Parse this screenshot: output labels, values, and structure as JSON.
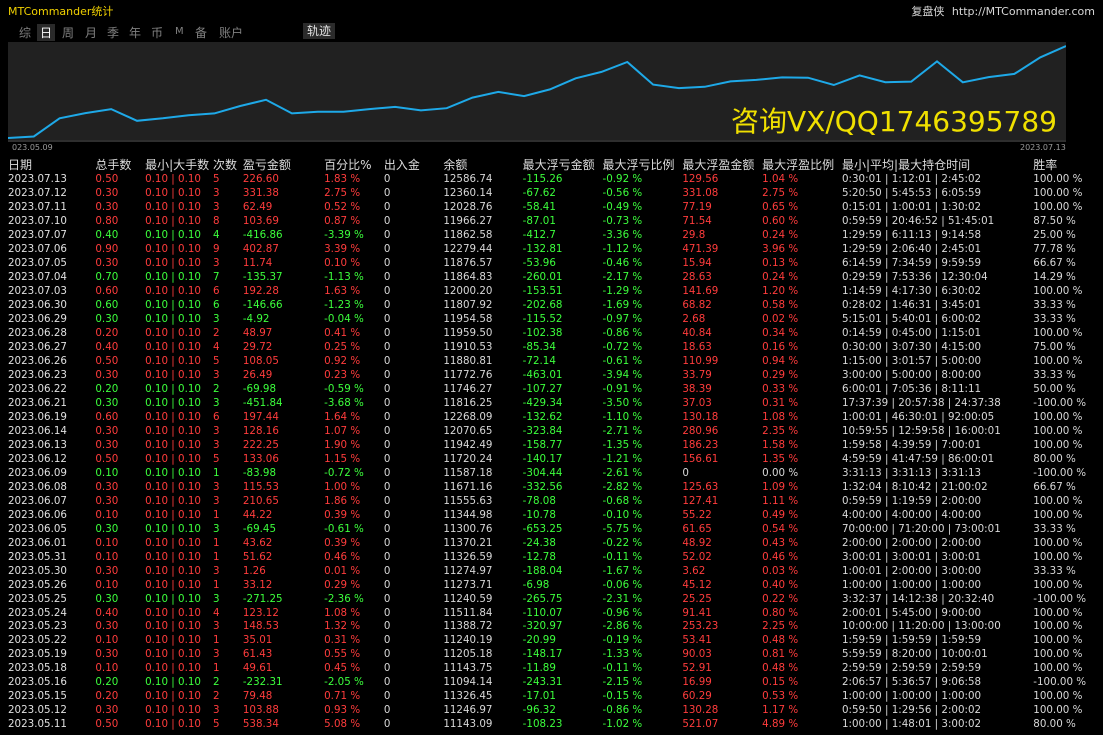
{
  "window": {
    "title": "MTCommander统计",
    "brand_label": "复盘侠",
    "brand_url": "http://MTCommander.com"
  },
  "tabs": [
    "综",
    "日",
    "周",
    "月",
    "季",
    "年",
    "币",
    "M",
    "备",
    "账户"
  ],
  "active_tab": "日",
  "track_button": "轨迹",
  "chart": {
    "start_label": "023.05.09",
    "end_label": "2023.07.13",
    "line_color": "#1ea9e8",
    "background": "#212121",
    "balance_points": [
      10750,
      10780,
      11143.09,
      11246.97,
      11326.45,
      11094.14,
      11143.75,
      11205.18,
      11240.19,
      11388.72,
      11511.84,
      11240.59,
      11273.71,
      11274.97,
      11326.59,
      11370.21,
      11300.76,
      11344.98,
      11555.63,
      11671.16,
      11587.18,
      11720.24,
      11942.49,
      12070.65,
      12268.09,
      11816.25,
      11746.27,
      11772.76,
      11880.81,
      11910.53,
      11959.5,
      11954.58,
      11807.92,
      12000.2,
      11864.83,
      11876.57,
      12279.44,
      11862.58,
      11966.27,
      12028.76,
      12360.14,
      12586.74
    ],
    "watermark": "咨询VX/QQ1746395789"
  },
  "table": {
    "headers": [
      "日期",
      "总手数",
      "最小|大手数",
      "次数",
      "盈亏金额",
      "百分比%",
      "出入金",
      "余额",
      "最大浮亏金额",
      "最大浮亏比例",
      "最大浮盈金额",
      "最大浮盈比例",
      "最小|平均|最大持仓时间",
      "胜率"
    ],
    "rows": [
      [
        "2023.07.13",
        "0.50",
        "0.10 | 0.10",
        "5",
        "226.60",
        "1.83 %",
        "0",
        "12586.74",
        "-115.26",
        "-0.92 %",
        "129.56",
        "1.04 %",
        "0:30:01 | 1:12:01 | 2:45:02",
        "100.00 %"
      ],
      [
        "2023.07.12",
        "0.30",
        "0.10 | 0.10",
        "3",
        "331.38",
        "2.75 %",
        "0",
        "12360.14",
        "-67.62",
        "-0.56 %",
        "331.08",
        "2.75 %",
        "5:20:50 | 5:45:53 | 6:05:59",
        "100.00 %"
      ],
      [
        "2023.07.11",
        "0.30",
        "0.10 | 0.10",
        "3",
        "62.49",
        "0.52 %",
        "0",
        "12028.76",
        "-58.41",
        "-0.49 %",
        "77.19",
        "0.65 %",
        "0:15:01 | 1:00:01 | 1:30:02",
        "100.00 %"
      ],
      [
        "2023.07.10",
        "0.80",
        "0.10 | 0.10",
        "8",
        "103.69",
        "0.87 %",
        "0",
        "11966.27",
        "-87.01",
        "-0.73 %",
        "71.54",
        "0.60 %",
        "0:59:59 | 20:46:52 | 51:45:01",
        "87.50 %"
      ],
      [
        "2023.07.07",
        "0.40",
        "0.10 | 0.10",
        "4",
        "-416.86",
        "-3.39 %",
        "0",
        "11862.58",
        "-412.7",
        "-3.36 %",
        "29.8",
        "0.24 %",
        "1:29:59 | 6:11:13 | 9:14:58",
        "25.00 %"
      ],
      [
        "2023.07.06",
        "0.90",
        "0.10 | 0.10",
        "9",
        "402.87",
        "3.39 %",
        "0",
        "12279.44",
        "-132.81",
        "-1.12 %",
        "471.39",
        "3.96 %",
        "1:29:59 | 2:06:40 | 2:45:01",
        "77.78 %"
      ],
      [
        "2023.07.05",
        "0.30",
        "0.10 | 0.10",
        "3",
        "11.74",
        "0.10 %",
        "0",
        "11876.57",
        "-53.96",
        "-0.46 %",
        "15.94",
        "0.13 %",
        "6:14:59 | 7:34:59 | 9:59:59",
        "66.67 %"
      ],
      [
        "2023.07.04",
        "0.70",
        "0.10 | 0.10",
        "7",
        "-135.37",
        "-1.13 %",
        "0",
        "11864.83",
        "-260.01",
        "-2.17 %",
        "28.63",
        "0.24 %",
        "0:29:59 | 7:53:36 | 12:30:04",
        "14.29 %"
      ],
      [
        "2023.07.03",
        "0.60",
        "0.10 | 0.10",
        "6",
        "192.28",
        "1.63 %",
        "0",
        "12000.20",
        "-153.51",
        "-1.29 %",
        "141.69",
        "1.20 %",
        "1:14:59 | 4:17:30 | 6:30:02",
        "100.00 %"
      ],
      [
        "2023.06.30",
        "0.60",
        "0.10 | 0.10",
        "6",
        "-146.66",
        "-1.23 %",
        "0",
        "11807.92",
        "-202.68",
        "-1.69 %",
        "68.82",
        "0.58 %",
        "0:28:02 | 1:46:31 | 3:45:01",
        "33.33 %"
      ],
      [
        "2023.06.29",
        "0.30",
        "0.10 | 0.10",
        "3",
        "-4.92",
        "-0.04 %",
        "0",
        "11954.58",
        "-115.52",
        "-0.97 %",
        "2.68",
        "0.02 %",
        "5:15:01 | 5:40:01 | 6:00:02",
        "33.33 %"
      ],
      [
        "2023.06.28",
        "0.20",
        "0.10 | 0.10",
        "2",
        "48.97",
        "0.41 %",
        "0",
        "11959.50",
        "-102.38",
        "-0.86 %",
        "40.84",
        "0.34 %",
        "0:14:59 | 0:45:00 | 1:15:01",
        "100.00 %"
      ],
      [
        "2023.06.27",
        "0.40",
        "0.10 | 0.10",
        "4",
        "29.72",
        "0.25 %",
        "0",
        "11910.53",
        "-85.34",
        "-0.72 %",
        "18.63",
        "0.16 %",
        "0:30:00 | 3:07:30 | 4:15:00",
        "75.00 %"
      ],
      [
        "2023.06.26",
        "0.50",
        "0.10 | 0.10",
        "5",
        "108.05",
        "0.92 %",
        "0",
        "11880.81",
        "-72.14",
        "-0.61 %",
        "110.99",
        "0.94 %",
        "1:15:00 | 3:01:57 | 5:00:00",
        "100.00 %"
      ],
      [
        "2023.06.23",
        "0.30",
        "0.10 | 0.10",
        "3",
        "26.49",
        "0.23 %",
        "0",
        "11772.76",
        "-463.01",
        "-3.94 %",
        "33.79",
        "0.29 %",
        "3:00:00 | 5:00:00 | 8:00:00",
        "33.33 %"
      ],
      [
        "2023.06.22",
        "0.20",
        "0.10 | 0.10",
        "2",
        "-69.98",
        "-0.59 %",
        "0",
        "11746.27",
        "-107.27",
        "-0.91 %",
        "38.39",
        "0.33 %",
        "6:00:01 | 7:05:36 | 8:11:11",
        "50.00 %"
      ],
      [
        "2023.06.21",
        "0.30",
        "0.10 | 0.10",
        "3",
        "-451.84",
        "-3.68 %",
        "0",
        "11816.25",
        "-429.34",
        "-3.50 %",
        "37.03",
        "0.31 %",
        "17:37:39 | 20:57:38 | 24:37:38",
        "-100.00 %"
      ],
      [
        "2023.06.19",
        "0.60",
        "0.10 | 0.10",
        "6",
        "197.44",
        "1.64 %",
        "0",
        "12268.09",
        "-132.62",
        "-1.10 %",
        "130.18",
        "1.08 %",
        "1:00:01 | 46:30:01 | 92:00:05",
        "100.00 %"
      ],
      [
        "2023.06.14",
        "0.30",
        "0.10 | 0.10",
        "3",
        "128.16",
        "1.07 %",
        "0",
        "12070.65",
        "-323.84",
        "-2.71 %",
        "280.96",
        "2.35 %",
        "10:59:55 | 12:59:58 | 16:00:01",
        "100.00 %"
      ],
      [
        "2023.06.13",
        "0.30",
        "0.10 | 0.10",
        "3",
        "222.25",
        "1.90 %",
        "0",
        "11942.49",
        "-158.77",
        "-1.35 %",
        "186.23",
        "1.58 %",
        "1:59:58 | 4:39:59 | 7:00:01",
        "100.00 %"
      ],
      [
        "2023.06.12",
        "0.50",
        "0.10 | 0.10",
        "5",
        "133.06",
        "1.15 %",
        "0",
        "11720.24",
        "-140.17",
        "-1.21 %",
        "156.61",
        "1.35 %",
        "4:59:59 | 41:47:59 | 86:00:01",
        "80.00 %"
      ],
      [
        "2023.06.09",
        "0.10",
        "0.10 | 0.10",
        "1",
        "-83.98",
        "-0.72 %",
        "0",
        "11587.18",
        "-304.44",
        "-2.61 %",
        "0",
        "0.00 %",
        "3:31:13 | 3:31:13 | 3:31:13",
        "-100.00 %"
      ],
      [
        "2023.06.08",
        "0.30",
        "0.10 | 0.10",
        "3",
        "115.53",
        "1.00 %",
        "0",
        "11671.16",
        "-332.56",
        "-2.82 %",
        "125.63",
        "1.09 %",
        "1:32:04 | 8:10:42 | 21:00:02",
        "66.67 %"
      ],
      [
        "2023.06.07",
        "0.30",
        "0.10 | 0.10",
        "3",
        "210.65",
        "1.86 %",
        "0",
        "11555.63",
        "-78.08",
        "-0.68 %",
        "127.41",
        "1.11 %",
        "0:59:59 | 1:19:59 | 2:00:00",
        "100.00 %"
      ],
      [
        "2023.06.06",
        "0.10",
        "0.10 | 0.10",
        "1",
        "44.22",
        "0.39 %",
        "0",
        "11344.98",
        "-10.78",
        "-0.10 %",
        "55.22",
        "0.49 %",
        "4:00:00 | 4:00:00 | 4:00:00",
        "100.00 %"
      ],
      [
        "2023.06.05",
        "0.30",
        "0.10 | 0.10",
        "3",
        "-69.45",
        "-0.61 %",
        "0",
        "11300.76",
        "-653.25",
        "-5.75 %",
        "61.65",
        "0.54 %",
        "70:00:00 | 71:20:00 | 73:00:01",
        "33.33 %"
      ],
      [
        "2023.06.01",
        "0.10",
        "0.10 | 0.10",
        "1",
        "43.62",
        "0.39 %",
        "0",
        "11370.21",
        "-24.38",
        "-0.22 %",
        "48.92",
        "0.43 %",
        "2:00:00 | 2:00:00 | 2:00:00",
        "100.00 %"
      ],
      [
        "2023.05.31",
        "0.10",
        "0.10 | 0.10",
        "1",
        "51.62",
        "0.46 %",
        "0",
        "11326.59",
        "-12.78",
        "-0.11 %",
        "52.02",
        "0.46 %",
        "3:00:01 | 3:00:01 | 3:00:01",
        "100.00 %"
      ],
      [
        "2023.05.30",
        "0.30",
        "0.10 | 0.10",
        "3",
        "1.26",
        "0.01 %",
        "0",
        "11274.97",
        "-188.04",
        "-1.67 %",
        "3.62",
        "0.03 %",
        "1:00:01 | 2:00:00 | 3:00:00",
        "33.33 %"
      ],
      [
        "2023.05.26",
        "0.10",
        "0.10 | 0.10",
        "1",
        "33.12",
        "0.29 %",
        "0",
        "11273.71",
        "-6.98",
        "-0.06 %",
        "45.12",
        "0.40 %",
        "1:00:00 | 1:00:00 | 1:00:00",
        "100.00 %"
      ],
      [
        "2023.05.25",
        "0.30",
        "0.10 | 0.10",
        "3",
        "-271.25",
        "-2.36 %",
        "0",
        "11240.59",
        "-265.75",
        "-2.31 %",
        "25.25",
        "0.22 %",
        "3:32:37 | 14:12:38 | 20:32:40",
        "-100.00 %"
      ],
      [
        "2023.05.24",
        "0.40",
        "0.10 | 0.10",
        "4",
        "123.12",
        "1.08 %",
        "0",
        "11511.84",
        "-110.07",
        "-0.96 %",
        "91.41",
        "0.80 %",
        "2:00:01 | 5:45:00 | 9:00:00",
        "100.00 %"
      ],
      [
        "2023.05.23",
        "0.30",
        "0.10 | 0.10",
        "3",
        "148.53",
        "1.32 %",
        "0",
        "11388.72",
        "-320.97",
        "-2.86 %",
        "253.23",
        "2.25 %",
        "10:00:00 | 11:20:00 | 13:00:00",
        "100.00 %"
      ],
      [
        "2023.05.22",
        "0.10",
        "0.10 | 0.10",
        "1",
        "35.01",
        "0.31 %",
        "0",
        "11240.19",
        "-20.99",
        "-0.19 %",
        "53.41",
        "0.48 %",
        "1:59:59 | 1:59:59 | 1:59:59",
        "100.00 %"
      ],
      [
        "2023.05.19",
        "0.30",
        "0.10 | 0.10",
        "3",
        "61.43",
        "0.55 %",
        "0",
        "11205.18",
        "-148.17",
        "-1.33 %",
        "90.03",
        "0.81 %",
        "5:59:59 | 8:20:00 | 10:00:01",
        "100.00 %"
      ],
      [
        "2023.05.18",
        "0.10",
        "0.10 | 0.10",
        "1",
        "49.61",
        "0.45 %",
        "0",
        "11143.75",
        "-11.89",
        "-0.11 %",
        "52.91",
        "0.48 %",
        "2:59:59 | 2:59:59 | 2:59:59",
        "100.00 %"
      ],
      [
        "2023.05.16",
        "0.20",
        "0.10 | 0.10",
        "2",
        "-232.31",
        "-2.05 %",
        "0",
        "11094.14",
        "-243.31",
        "-2.15 %",
        "16.99",
        "0.15 %",
        "2:06:57 | 5:36:57 | 9:06:58",
        "-100.00 %"
      ],
      [
        "2023.05.15",
        "0.20",
        "0.10 | 0.10",
        "2",
        "79.48",
        "0.71 %",
        "0",
        "11326.45",
        "-17.01",
        "-0.15 %",
        "60.29",
        "0.53 %",
        "1:00:00 | 1:00:00 | 1:00:00",
        "100.00 %"
      ],
      [
        "2023.05.12",
        "0.30",
        "0.10 | 0.10",
        "3",
        "103.88",
        "0.93 %",
        "0",
        "11246.97",
        "-96.32",
        "-0.86 %",
        "130.28",
        "1.17 %",
        "0:59:50 | 1:29:56 | 2:00:02",
        "100.00 %"
      ],
      [
        "2023.05.11",
        "0.50",
        "0.10 | 0.10",
        "5",
        "538.34",
        "5.08 %",
        "0",
        "11143.09",
        "-108.23",
        "-1.02 %",
        "521.07",
        "4.89 %",
        "1:00:00 | 1:48:01 | 3:00:02",
        "80.00 %"
      ]
    ]
  }
}
